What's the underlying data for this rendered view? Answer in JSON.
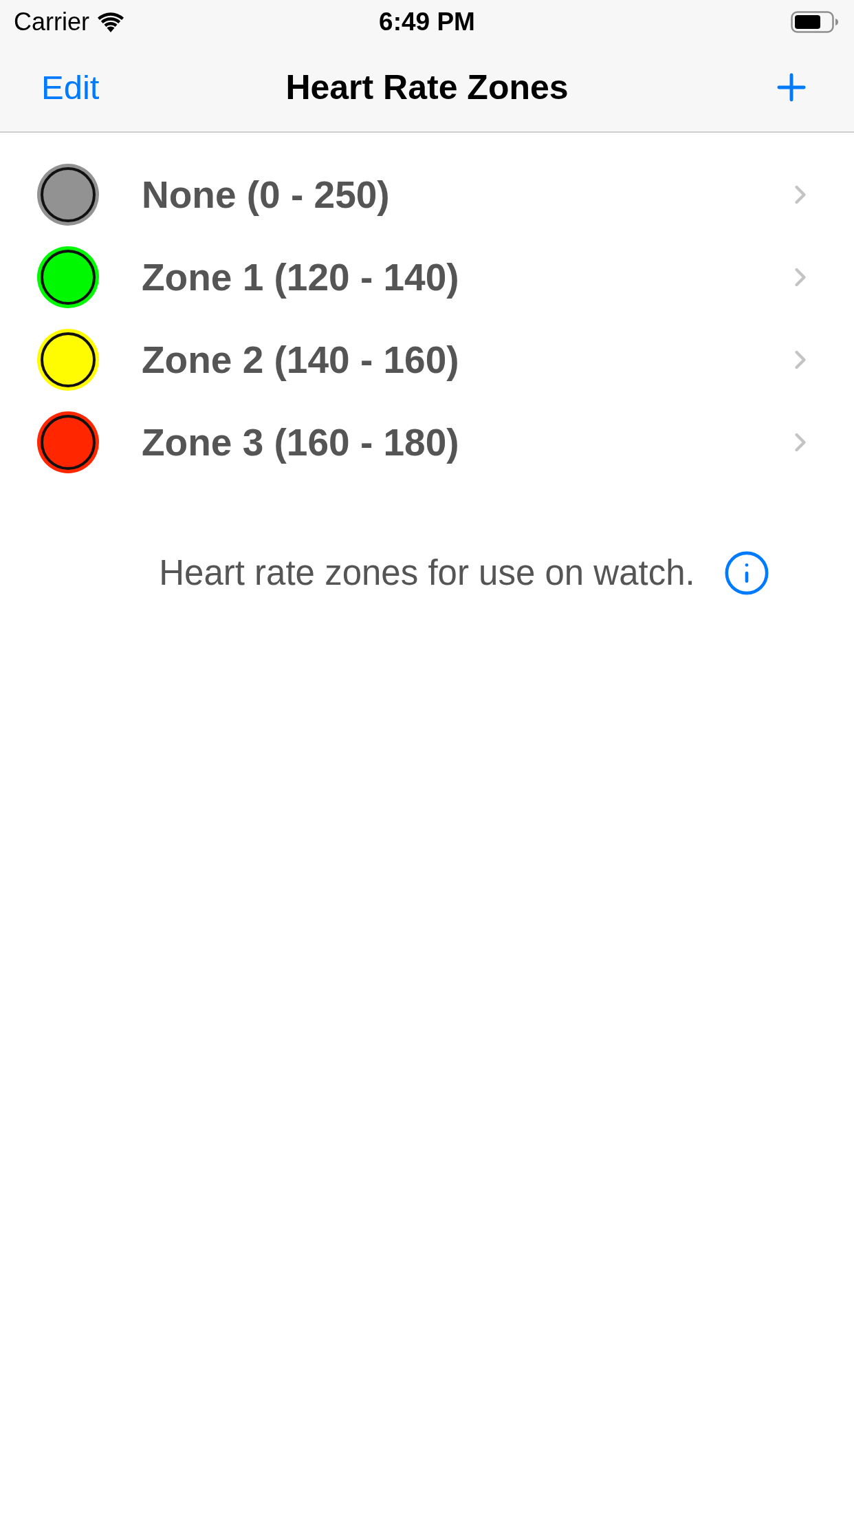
{
  "status_bar": {
    "carrier": "Carrier",
    "time": "6:49 PM"
  },
  "nav_bar": {
    "left_button": "Edit",
    "title": "Heart Rate Zones"
  },
  "zones": [
    {
      "label": "None (0 - 250)",
      "color": "#929292"
    },
    {
      "label": "Zone 1 (120 - 140)",
      "color": "#00f900"
    },
    {
      "label": "Zone 2 (140 - 160)",
      "color": "#fffb00"
    },
    {
      "label": "Zone 3 (160 - 180)",
      "color": "#ff2600"
    }
  ],
  "footer": {
    "text": "Heart rate zones for use on watch."
  }
}
